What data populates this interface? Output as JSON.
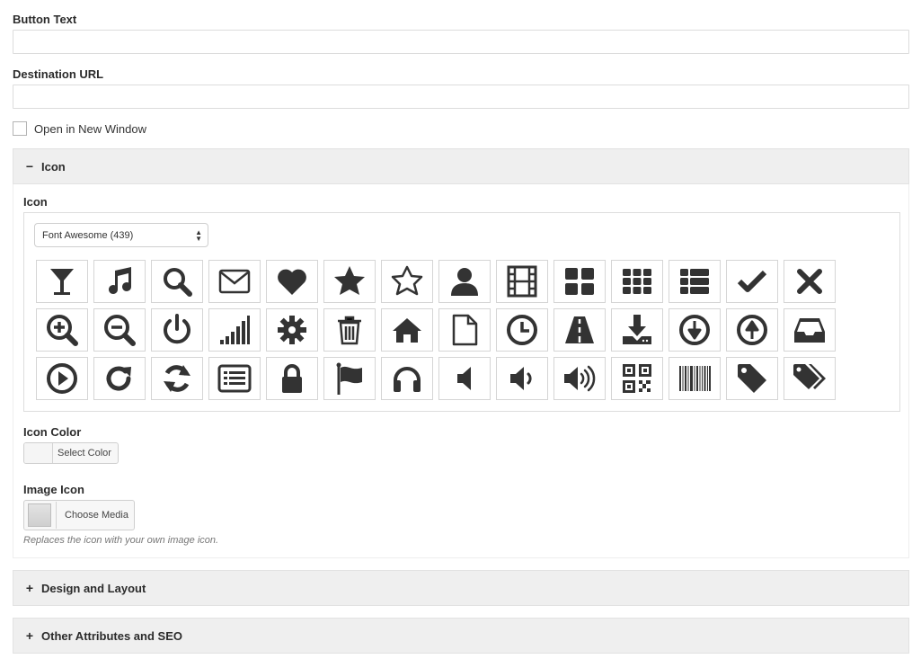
{
  "form": {
    "button_text_label": "Button Text",
    "button_text_value": "",
    "destination_label": "Destination URL",
    "destination_value": "",
    "new_window_label": "Open in New Window",
    "new_window_checked": false
  },
  "sections": {
    "icon": {
      "toggle": "−",
      "title": "Icon"
    },
    "design": {
      "toggle": "+",
      "title": "Design and Layout"
    },
    "other": {
      "toggle": "+",
      "title": "Other Attributes and SEO"
    }
  },
  "icon_section": {
    "icon_label": "Icon",
    "icon_set_selected": "Font Awesome (439)",
    "icons": [
      "glass-icon",
      "music-icon",
      "search-icon",
      "envelope-icon",
      "heart-icon",
      "star-icon",
      "star-outline-icon",
      "user-icon",
      "film-icon",
      "th-large-icon",
      "th-icon",
      "th-list-icon",
      "check-icon",
      "times-icon",
      "zoom-in-icon",
      "zoom-out-icon",
      "power-off-icon",
      "signal-icon",
      "gear-icon",
      "trash-icon",
      "home-icon",
      "file-outline-icon",
      "clock-icon",
      "road-icon",
      "download-icon",
      "arrow-circle-down-icon",
      "arrow-circle-up-icon",
      "inbox-icon",
      "play-circle-icon",
      "repeat-icon",
      "refresh-icon",
      "list-alt-icon",
      "lock-icon",
      "flag-icon",
      "headphones-icon",
      "volume-off-icon",
      "volume-down-icon",
      "volume-up-icon",
      "qrcode-icon",
      "barcode-icon",
      "tag-icon",
      "tags-icon"
    ],
    "icon_color": "#333333",
    "color_label": "Icon Color",
    "color_button": "Select Color",
    "image_icon_label": "Image Icon",
    "media_button": "Choose Media",
    "hint": "Replaces the icon with your own image icon."
  }
}
